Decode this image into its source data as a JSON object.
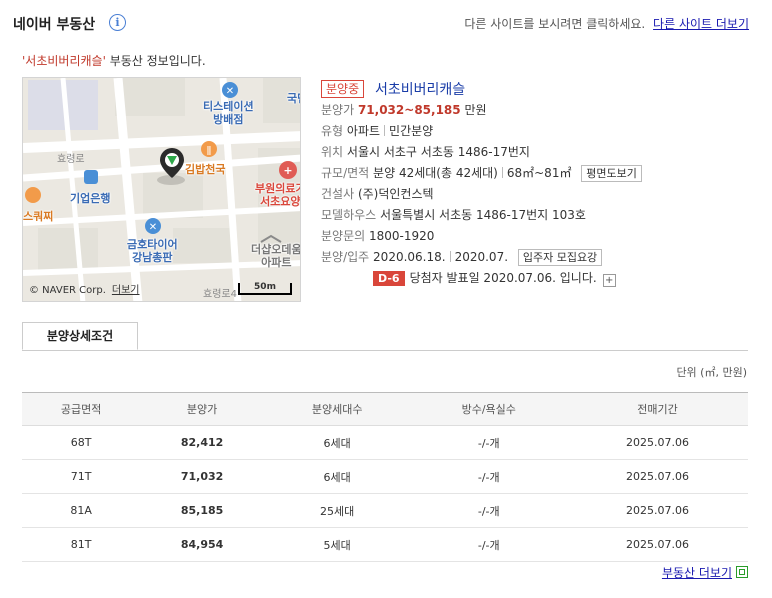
{
  "header": {
    "brand": "네이버 부동산",
    "info_icon": "i",
    "prompt": "다른 사이트를 보시려면 클릭하세요.",
    "link": "다른 사이트 더보기"
  },
  "intro": {
    "name_quoted": "'서초비버리캐슬'",
    "suffix": " 부동산 정보입니다."
  },
  "map": {
    "labels": {
      "tstation": "티스테이션\n방배점",
      "kimbap": "김밥천국",
      "ibk": "기업은행",
      "hospital": "부원의료기\n서초요양",
      "tire": "금호타이어\n강남총판",
      "apt": "더샵오데움\n아파트",
      "coffee": "스쿼찌",
      "road1": "효령로",
      "road2": "효령로4",
      "corner": "국민"
    },
    "copyright": "© NAVER Corp.",
    "more_link": "더보기",
    "scale": "50m"
  },
  "property": {
    "status_badge": "분양중",
    "title": "서초비버리캐슬",
    "rows": {
      "price_label": "분양가",
      "price_value": "71,032~85,185",
      "price_unit": "만원",
      "type_label": "유형",
      "type_value1": "아파트",
      "type_value2": "민간분양",
      "location_label": "위치",
      "location_value": "서울시 서초구 서초동 1486-17번지",
      "size_label": "규모/면적",
      "size_value1": "분양 42세대(총 42세대)",
      "size_value2": "68㎡~81㎡",
      "floorplan_btn": "평면도보기",
      "builder_label": "건설사",
      "builder_value": "(주)덕인컨스텍",
      "modelhouse_label": "모델하우스",
      "modelhouse_value": "서울특별시 서초동 1486-17번지 103호",
      "inquiry_label": "분양문의",
      "inquiry_value": "1800-1920",
      "dates_label": "분양/입주",
      "dates_value1": "2020.06.18.",
      "dates_value2": "2020.07.",
      "notice_btn": "입주자 모집요강",
      "dday": "D-6",
      "dday_text": "당첨자 발표일 2020.07.06. 입니다.",
      "plus": "+"
    }
  },
  "tabs": [
    {
      "label": "분양상세조건",
      "active": true
    }
  ],
  "unit_note": "단위 (㎡, 만원)",
  "table": {
    "headers": [
      "공급면적",
      "분양가",
      "분양세대수",
      "방수/욕실수",
      "전매기간"
    ],
    "rows": [
      [
        "68T",
        "82,412",
        "6세대",
        "-/-개",
        "2025.07.06"
      ],
      [
        "71T",
        "71,032",
        "6세대",
        "-/-개",
        "2025.07.06"
      ],
      [
        "81A",
        "85,185",
        "25세대",
        "-/-개",
        "2025.07.06"
      ],
      [
        "81T",
        "84,954",
        "5세대",
        "-/-개",
        "2025.07.06"
      ]
    ]
  },
  "footer": {
    "more_link": "부동산 더보기"
  },
  "colors": {
    "accent_red": "#d9463a",
    "link_blue": "#1a1ab0",
    "title_blue": "#1a3da8"
  }
}
